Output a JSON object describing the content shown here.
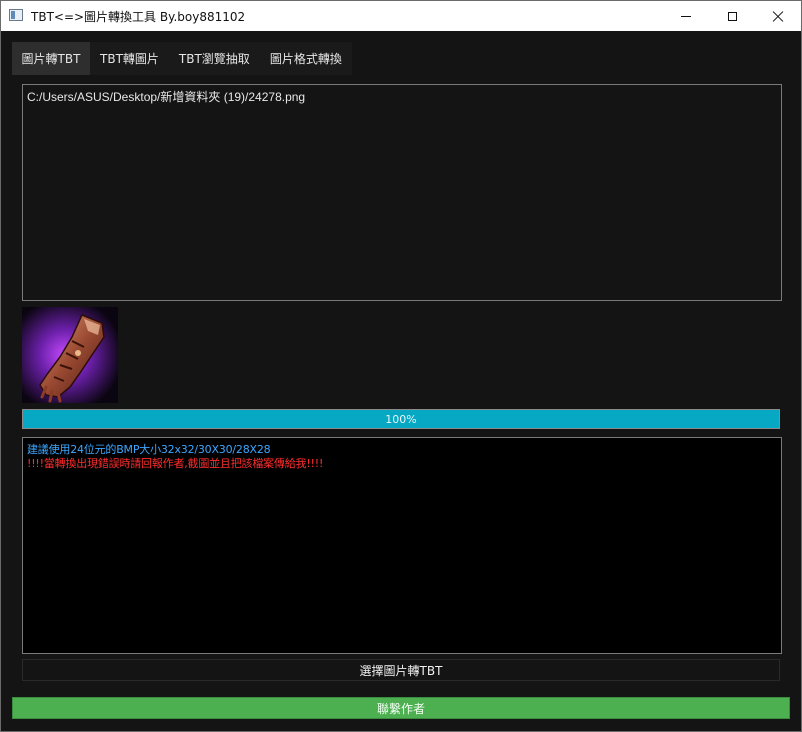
{
  "window": {
    "title": "TBT<=>圖片轉換工具 By.boy881102"
  },
  "tabs": [
    {
      "label": "圖片轉TBT",
      "active": true
    },
    {
      "label": "TBT轉圖片",
      "active": false
    },
    {
      "label": "TBT瀏覽抽取",
      "active": false
    },
    {
      "label": "圖片格式轉換",
      "active": false
    }
  ],
  "file_list": {
    "path": "C:/Users/ASUS/Desktop/新增資料夾 (19)/24278.png"
  },
  "preview": {
    "icon": "gauntlet-item-icon"
  },
  "progress": {
    "value": 100,
    "label": "100%",
    "color": "#06a8c4"
  },
  "log": {
    "info_line": "建議使用24位元的BMP大小32x32/30X30/28X28",
    "warning_line": "!!!!當轉換出現錯誤時請回報作者,截圖並且把該檔案傳給我!!!!",
    "info_color": "#3da6ff",
    "warning_color": "#ff2d2d"
  },
  "buttons": {
    "select_label": "選擇圖片轉TBT",
    "contact_label": "聯繫作者",
    "contact_color": "#4caf50"
  }
}
